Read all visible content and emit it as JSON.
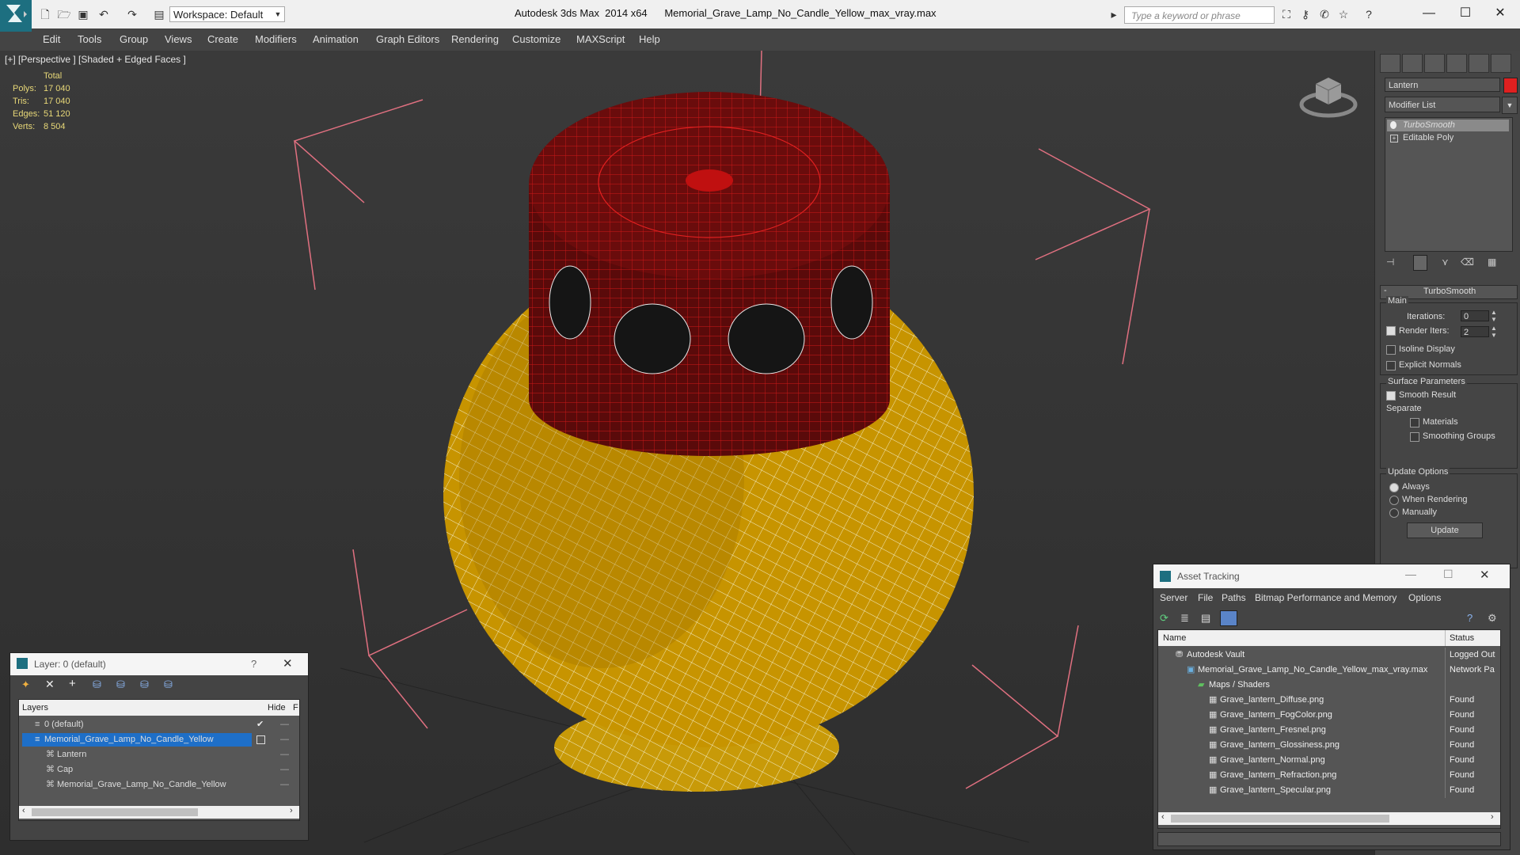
{
  "titlebar": {
    "workspace_label": "Workspace: Default",
    "app_title": "Autodesk 3ds Max  2014 x64      Memorial_Grave_Lamp_No_Candle_Yellow_max_vray.max",
    "search_placeholder": "Type a keyword or phrase"
  },
  "menu": [
    "Edit",
    "Tools",
    "Group",
    "Views",
    "Create",
    "Modifiers",
    "Animation",
    "Graph Editors",
    "Rendering",
    "Customize",
    "MAXScript",
    "Help"
  ],
  "viewport": {
    "label": "[+] [Perspective ] [Shaded + Edged Faces ]",
    "stats_header": "Total",
    "stats": [
      {
        "label": "Polys:",
        "value": "17 040"
      },
      {
        "label": "Tris:",
        "value": "17 040"
      },
      {
        "label": "Edges:",
        "value": "51 120"
      },
      {
        "label": "Verts:",
        "value": "8 504"
      }
    ]
  },
  "command_panel": {
    "object_name": "Lantern",
    "object_color": "#e02020",
    "modifier_list": "Modifier List",
    "stack": [
      "TurboSmooth",
      "Editable Poly"
    ],
    "rollout_title": "TurboSmooth",
    "main_label": "Main",
    "iterations_label": "Iterations:",
    "iterations_value": "0",
    "render_iters_label": "Render Iters:",
    "render_iters_value": "2",
    "isoline_label": "Isoline Display",
    "explicit_label": "Explicit Normals",
    "surface_label": "Surface Parameters",
    "smooth_label": "Smooth Result",
    "separate_label": "Separate",
    "materials_label": "Materials",
    "smoothing_groups_label": "Smoothing Groups",
    "update_options_label": "Update Options",
    "always_label": "Always",
    "when_rendering_label": "When Rendering",
    "manually_label": "Manually",
    "update_button": "Update"
  },
  "layer_window": {
    "title": "Layer: 0 (default)",
    "help": "?",
    "col_layers": "Layers",
    "col_hide": "Hide",
    "col_f": "F",
    "rows": [
      {
        "name": "0 (default)",
        "indent": 0,
        "selected": false
      },
      {
        "name": "Memorial_Grave_Lamp_No_Candle_Yellow",
        "indent": 0,
        "selected": true
      },
      {
        "name": "Lantern",
        "indent": 1,
        "selected": false
      },
      {
        "name": "Cap",
        "indent": 1,
        "selected": false
      },
      {
        "name": "Memorial_Grave_Lamp_No_Candle_Yellow",
        "indent": 1,
        "selected": false
      }
    ]
  },
  "asset_window": {
    "title": "Asset Tracking",
    "menu": [
      "Server",
      "File",
      "Paths",
      "Bitmap Performance and Memory",
      "Options"
    ],
    "col_name": "Name",
    "col_status": "Status",
    "rows": [
      {
        "name": "Autodesk Vault",
        "status": "Logged Out",
        "indent": 1,
        "icon": "vault-icon"
      },
      {
        "name": "Memorial_Grave_Lamp_No_Candle_Yellow_max_vray.max",
        "status": "Network Pa",
        "indent": 2,
        "icon": "max-file-icon"
      },
      {
        "name": "Maps / Shaders",
        "status": "",
        "indent": 3,
        "icon": "maps-folder-icon"
      },
      {
        "name": "Grave_lantern_Diffuse.png",
        "status": "Found",
        "indent": 4,
        "icon": "image-file-icon"
      },
      {
        "name": "Grave_lantern_FogColor.png",
        "status": "Found",
        "indent": 4,
        "icon": "image-file-icon"
      },
      {
        "name": "Grave_lantern_Fresnel.png",
        "status": "Found",
        "indent": 4,
        "icon": "image-file-icon"
      },
      {
        "name": "Grave_lantern_Glossiness.png",
        "status": "Found",
        "indent": 4,
        "icon": "image-file-icon"
      },
      {
        "name": "Grave_lantern_Normal.png",
        "status": "Found",
        "indent": 4,
        "icon": "image-file-icon"
      },
      {
        "name": "Grave_lantern_Refraction.png",
        "status": "Found",
        "indent": 4,
        "icon": "image-file-icon"
      },
      {
        "name": "Grave_lantern_Specular.png",
        "status": "Found",
        "indent": 4,
        "icon": "image-file-icon"
      }
    ]
  }
}
